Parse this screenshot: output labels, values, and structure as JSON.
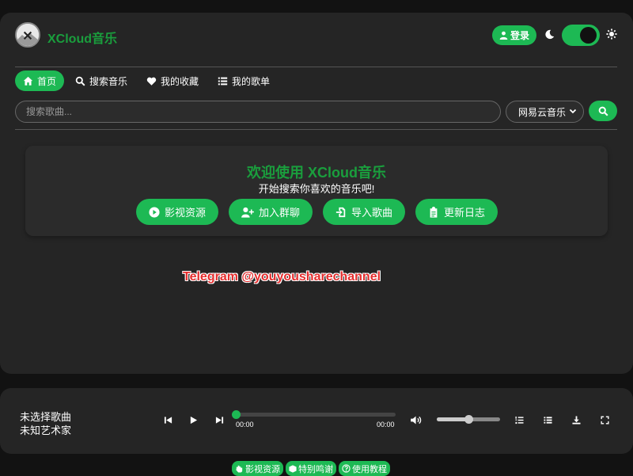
{
  "header": {
    "brand": "XCloud音乐",
    "login_label": "登录",
    "theme_toggle_on": true
  },
  "nav": {
    "items": [
      {
        "label": "首页",
        "icon": "home-icon",
        "active": true
      },
      {
        "label": "搜索音乐",
        "icon": "search-icon",
        "active": false
      },
      {
        "label": "我的收藏",
        "icon": "heart-icon",
        "active": false
      },
      {
        "label": "我的歌单",
        "icon": "list-icon",
        "active": false
      }
    ]
  },
  "search": {
    "placeholder": "搜索歌曲...",
    "value": "",
    "source_selected": "网易云音乐"
  },
  "welcome": {
    "title": "欢迎使用 XCloud音乐",
    "subtitle": "开始搜索你喜欢的音乐吧!",
    "actions": [
      {
        "label": "影视资源",
        "icon": "play-circle-icon"
      },
      {
        "label": "加入群聊",
        "icon": "user-plus-icon"
      },
      {
        "label": "导入歌曲",
        "icon": "file-import-icon"
      },
      {
        "label": "更新日志",
        "icon": "clipboard-icon"
      }
    ]
  },
  "watermark": "Telegram @youyousharechannel",
  "player": {
    "song_title": "未选择歌曲",
    "artist": "未知艺术家",
    "current_time": "00:00",
    "total_time": "00:00",
    "progress": 0,
    "volume": 0.5
  },
  "footer": {
    "links": [
      {
        "label": "影视资源",
        "icon": "hand-icon"
      },
      {
        "label": "特别鸣谢",
        "icon": "cube-icon"
      },
      {
        "label": "使用教程",
        "icon": "question-circle-icon"
      }
    ]
  },
  "colors": {
    "accent": "#1db954",
    "brand_text": "#1a9e3d",
    "watermark": "#e52e2e"
  }
}
